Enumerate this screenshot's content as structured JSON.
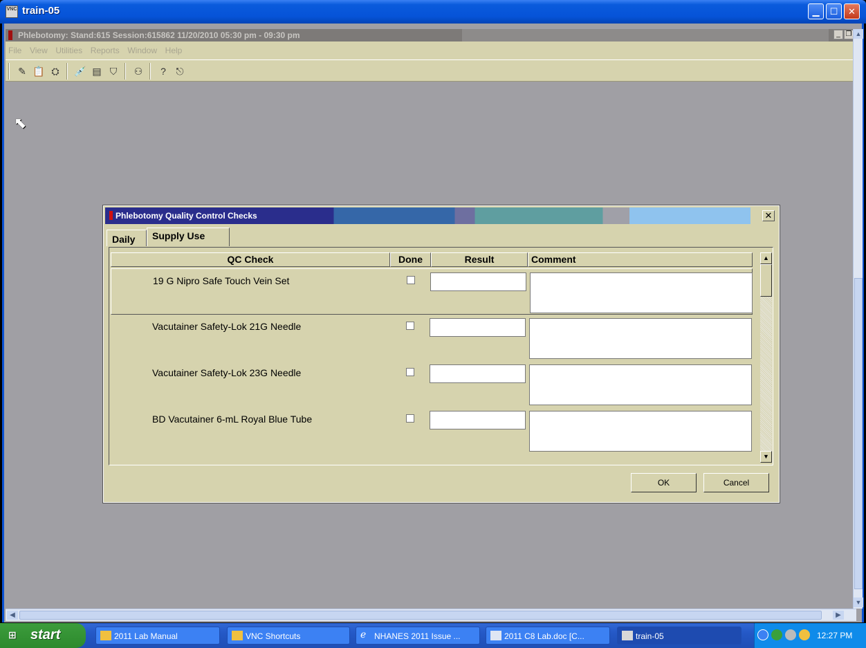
{
  "vnc_window": {
    "title": "train-05",
    "app_icon_text": "VNC"
  },
  "app": {
    "caption": "Phlebotomy: Stand:615 Session:615862 11/20/2010 05:30 pm - 09:30 pm",
    "menu": [
      "File",
      "View",
      "Utilities",
      "Reports",
      "Window",
      "Help"
    ]
  },
  "dialog": {
    "title": "Phlebotomy Quality Control Checks",
    "tabs": [
      "Daily",
      "Supply Use"
    ],
    "active_tab": "Supply Use",
    "columns": [
      "QC Check",
      "Done",
      "Result",
      "Comment"
    ],
    "rows": [
      {
        "qc_check": "19 G Nipro Safe Touch Vein Set",
        "done": false,
        "result": "",
        "comment": ""
      },
      {
        "qc_check": "Vacutainer Safety-Lok  21G Needle",
        "done": false,
        "result": "",
        "comment": ""
      },
      {
        "qc_check": "Vacutainer Safety-Lok  23G Needle",
        "done": false,
        "result": "",
        "comment": ""
      },
      {
        "qc_check": "BD Vacutainer 6-mL Royal Blue Tube",
        "done": false,
        "result": "",
        "comment": ""
      }
    ],
    "ok_label": "OK",
    "cancel_label": "Cancel"
  },
  "taskbar": {
    "start_label": "start",
    "tasks": [
      "2011 Lab Manual",
      "VNC Shortcuts",
      "NHANES 2011 Issue ...",
      "2011 C8 Lab.doc [C...",
      "train-05"
    ],
    "clock": "12:27 PM"
  },
  "colors": {
    "dialog_bg": "#d6d3ae",
    "desktop_bg": "#a09fa4",
    "xp_blue": "#0653d8"
  }
}
